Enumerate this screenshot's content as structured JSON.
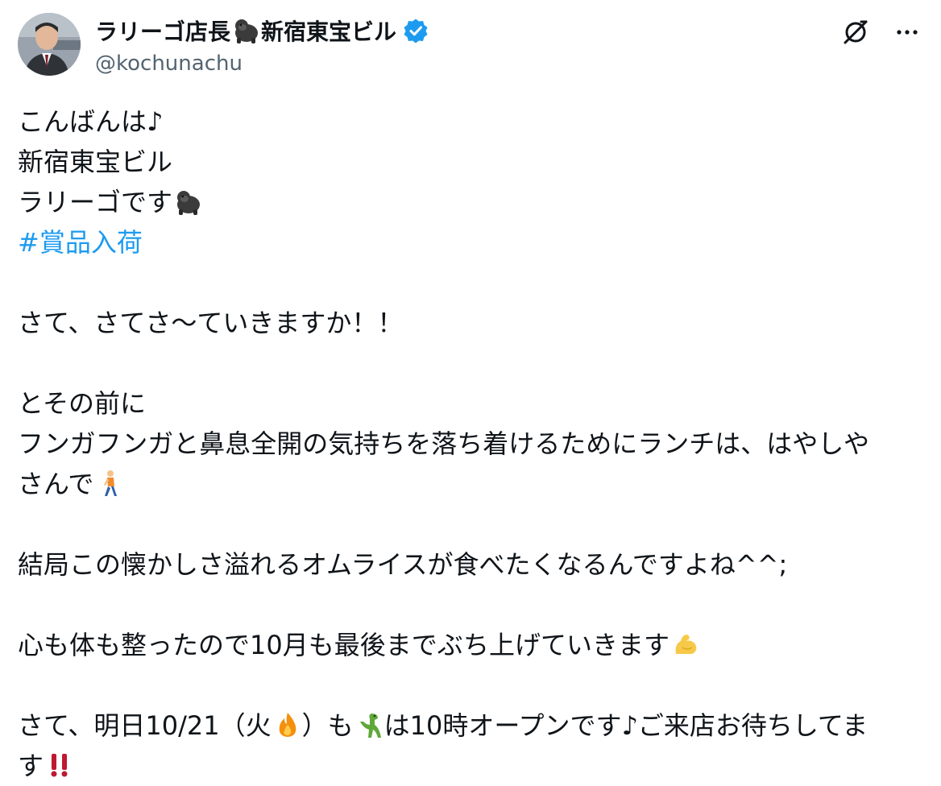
{
  "author": {
    "display_name": "ラリーゴ店長",
    "display_name_suffix": "新宿東宝ビル",
    "handle": "@kochunachu",
    "verified": true,
    "avatar_icon": "person-photo"
  },
  "actions": {
    "grok_icon": "grok-icon",
    "more_icon": "more-horizontal-icon"
  },
  "post": {
    "line1": "こんばんは♪",
    "line2": "新宿東宝ビル",
    "line3": "ラリーゴです",
    "hashtag": "#賞品入荷",
    "line5": "さて、さてさ〜ていきますか！！",
    "line6": "とその前に",
    "line7": "フンガフンガと鼻息全開の気持ちを落ち着けるためにランチは、はやしや",
    "line8": "さんで",
    "line9": "結局この懐かしさ溢れるオムライスが食べたくなるんですよね^^;",
    "line10": "心も体も整ったので10月も最後までぶち上げていきます",
    "line11a": "さて、明日10/21（火",
    "line11b": "）も",
    "line11c": "は10時オープンです♪ご来店お待ちしてま",
    "line12": "す"
  },
  "colors": {
    "text": "#0f1419",
    "secondary": "#536471",
    "link": "#1d9bf0",
    "verified": "#1d9bf0"
  }
}
